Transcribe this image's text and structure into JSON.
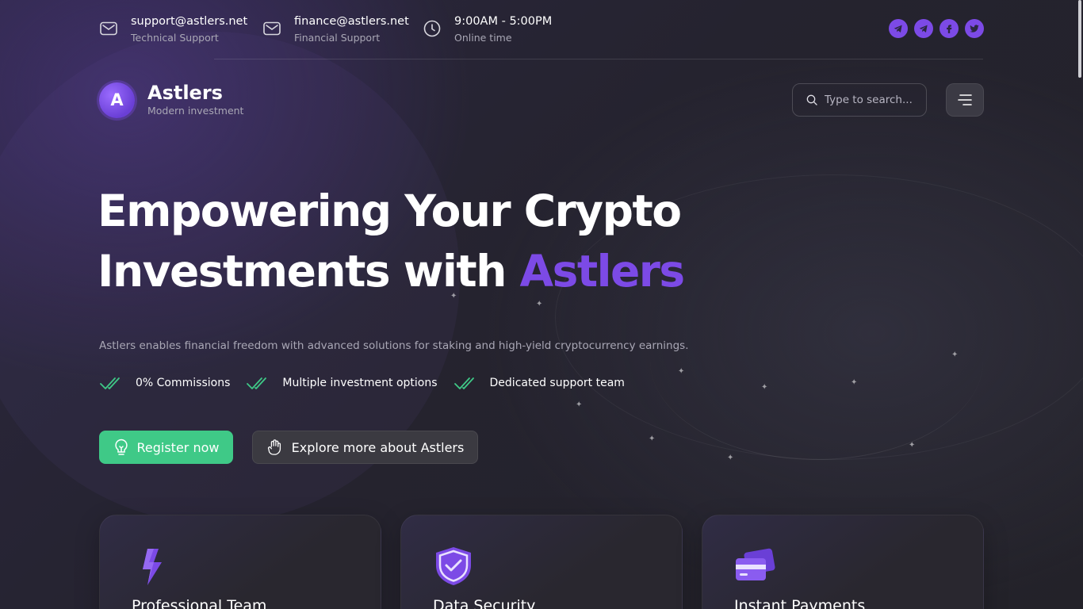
{
  "topbar": {
    "contacts": [
      {
        "main": "support@astlers.net",
        "sub": "Technical Support",
        "icon": "mail-icon"
      },
      {
        "main": "finance@astlers.net",
        "sub": "Financial Support",
        "icon": "mail-icon"
      },
      {
        "main": "9:00AM - 5:00PM",
        "sub": "Online time",
        "icon": "clock-icon"
      }
    ],
    "socials": [
      {
        "name": "telegram-icon",
        "glyph": "➤"
      },
      {
        "name": "telegram-icon",
        "glyph": "➤"
      },
      {
        "name": "facebook-icon",
        "glyph": "f"
      },
      {
        "name": "twitter-icon",
        "glyph": "t"
      }
    ],
    "accent": "#7c4ae6"
  },
  "header": {
    "logo_letter": "A",
    "brand": "Astlers",
    "tagline": "Modern investment",
    "search_placeholder": "Type to search..."
  },
  "hero": {
    "title_line1": "Empowering Your Crypto",
    "title_line2_prefix": "Investments with ",
    "title_line2_accent": "Astlers",
    "description": "Astlers enables financial freedom with advanced solutions for staking and high-yield cryptocurrency earnings.",
    "features": [
      "0% Commissions",
      "Multiple investment options",
      "Dedicated support team"
    ],
    "register_label": "Register now",
    "explore_label": "Explore more about Astlers"
  },
  "cards": [
    {
      "title": "Professional Team",
      "icon": "lightning-icon"
    },
    {
      "title": "Data Security",
      "icon": "shield-check-icon"
    },
    {
      "title": "Instant Payments",
      "icon": "credit-card-icon"
    }
  ],
  "colors": {
    "accent": "#7c4ae6",
    "success": "#3fc987",
    "background": "#25232f"
  }
}
